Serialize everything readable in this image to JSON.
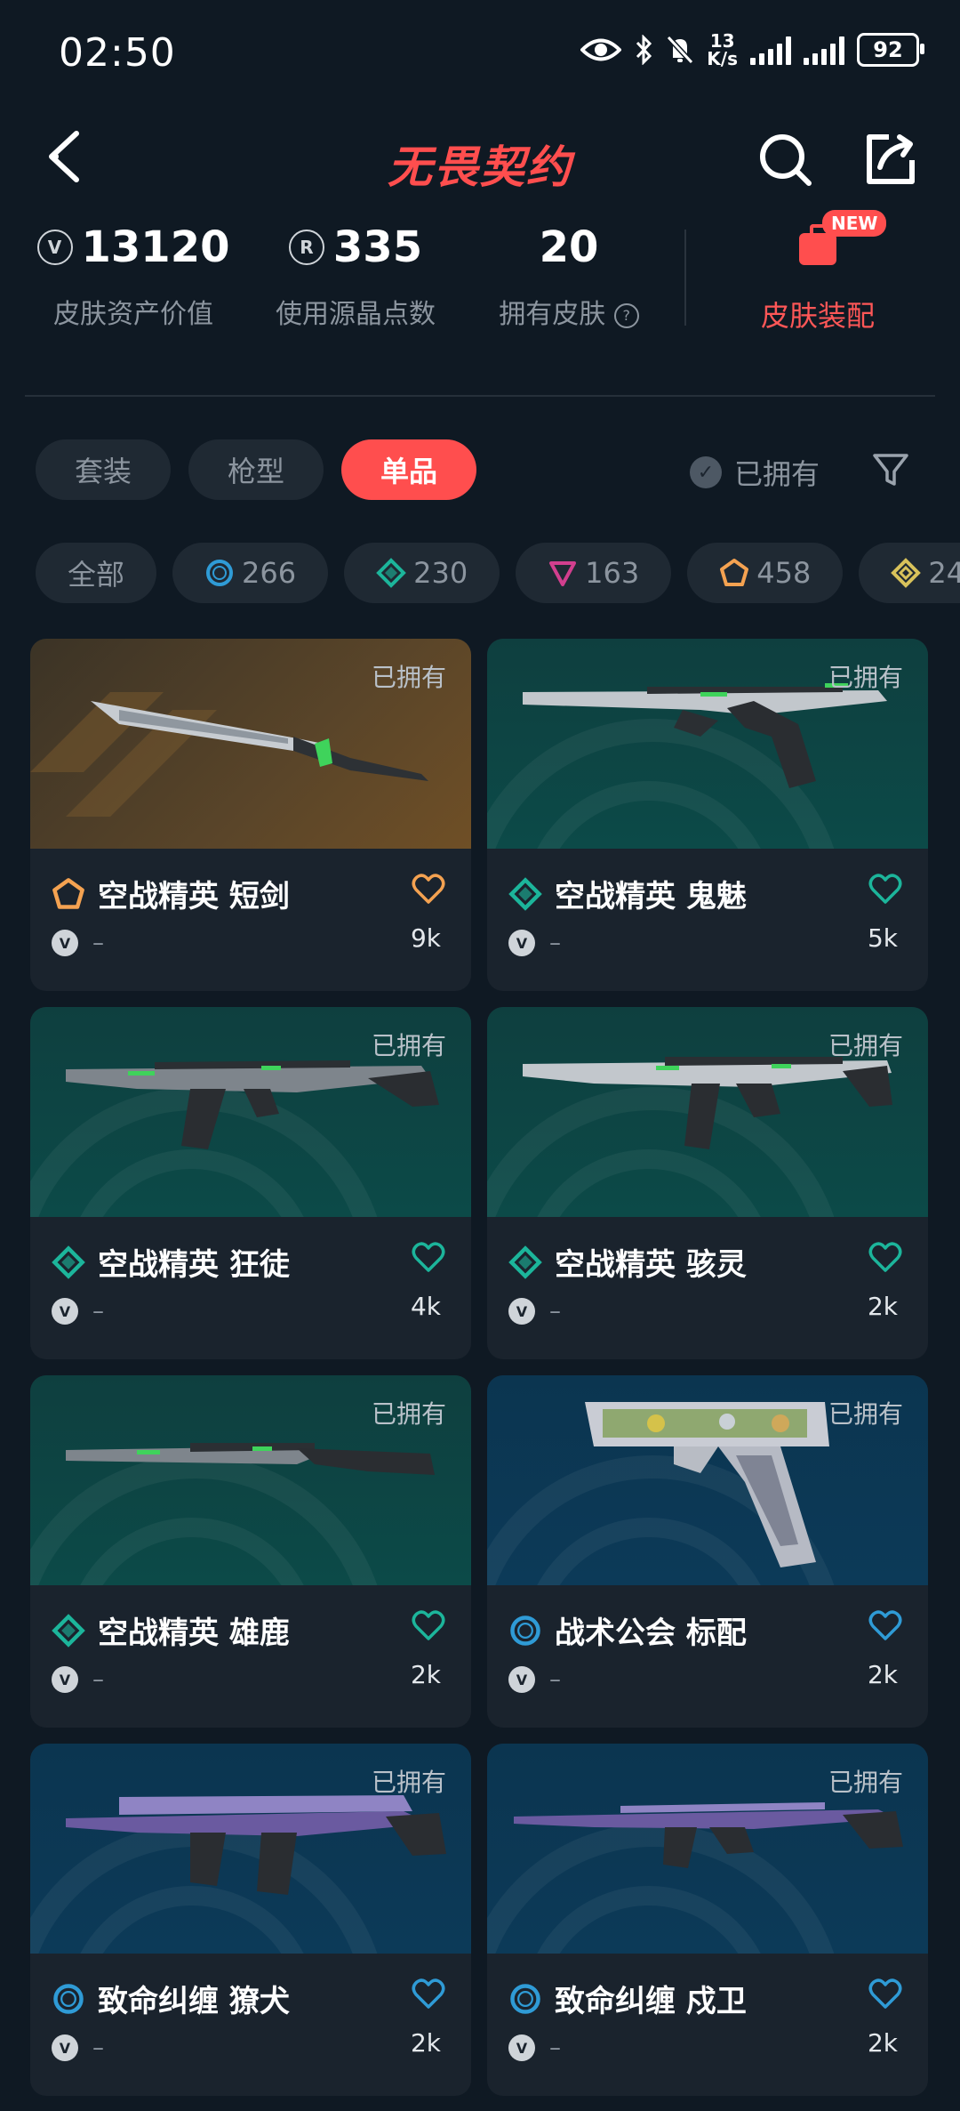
{
  "status_bar": {
    "time": "02:50",
    "net_speed_top": "13",
    "net_speed_unit": "K/s",
    "battery": "92"
  },
  "header": {
    "logo": "无畏契约"
  },
  "stats": [
    {
      "value": "13120",
      "label": "皮肤资产价值",
      "icon": "valorant-icon"
    },
    {
      "value": "335",
      "label": "使用源晶点数",
      "icon": "radianite-icon"
    },
    {
      "value": "20",
      "label": "拥有皮肤",
      "icon": "help-icon"
    }
  ],
  "equip": {
    "label": "皮肤装配",
    "badge": "NEW"
  },
  "tabs": [
    {
      "label": "套装",
      "active": false
    },
    {
      "label": "枪型",
      "active": false
    },
    {
      "label": "单品",
      "active": true
    }
  ],
  "owned_filter": {
    "label": "已拥有"
  },
  "chips": [
    {
      "label": "全部",
      "icon": ""
    },
    {
      "label": "266",
      "icon": "select-tier-icon",
      "color": "#2f9bd6"
    },
    {
      "label": "230",
      "icon": "deluxe-tier-icon",
      "color": "#1cb59b"
    },
    {
      "label": "163",
      "icon": "premium-tier-icon",
      "color": "#d23f8e"
    },
    {
      "label": "458",
      "icon": "ultra-tier-icon",
      "color": "#f4a251"
    },
    {
      "label": "24",
      "icon": "exclusive-tier-icon",
      "color": "#d8c25b"
    }
  ],
  "cards": [
    {
      "name": "空战精英 短剑",
      "owned": "已拥有",
      "likes": "9k",
      "price": "–",
      "tier": "ultra",
      "tier_color": "#f4a251",
      "heart_color": "#f4a251",
      "bg": "orange",
      "weapon": "knife"
    },
    {
      "name": "空战精英 鬼魅",
      "owned": "已拥有",
      "likes": "5k",
      "price": "–",
      "tier": "deluxe",
      "tier_color": "#1cb59b",
      "heart_color": "#1cb59b",
      "bg": "teal",
      "weapon": "pistol"
    },
    {
      "name": "空战精英 狂徒",
      "owned": "已拥有",
      "likes": "4k",
      "price": "–",
      "tier": "deluxe",
      "tier_color": "#1cb59b",
      "heart_color": "#1cb59b",
      "bg": "teal",
      "weapon": "rifle"
    },
    {
      "name": "空战精英 骇灵",
      "owned": "已拥有",
      "likes": "2k",
      "price": "–",
      "tier": "deluxe",
      "tier_color": "#1cb59b",
      "heart_color": "#1cb59b",
      "bg": "teal",
      "weapon": "smg"
    },
    {
      "name": "空战精英 雄鹿",
      "owned": "已拥有",
      "likes": "2k",
      "price": "–",
      "tier": "deluxe",
      "tier_color": "#1cb59b",
      "heart_color": "#1cb59b",
      "bg": "teal",
      "weapon": "shotgun"
    },
    {
      "name": "战术公会 标配",
      "owned": "已拥有",
      "likes": "2k",
      "price": "–",
      "tier": "select",
      "tier_color": "#2f9bd6",
      "heart_color": "#2f9bd6",
      "bg": "blue",
      "weapon": "handgun"
    },
    {
      "name": "致命纠缠 獠犬",
      "owned": "已拥有",
      "likes": "2k",
      "price": "–",
      "tier": "select",
      "tier_color": "#2f9bd6",
      "heart_color": "#2f9bd6",
      "bg": "blue",
      "weapon": "bulldog"
    },
    {
      "name": "致命纠缠 戍卫",
      "owned": "已拥有",
      "likes": "2k",
      "price": "–",
      "tier": "select",
      "tier_color": "#2f9bd6",
      "heart_color": "#2f9bd6",
      "bg": "blue",
      "weapon": "guardian"
    }
  ]
}
